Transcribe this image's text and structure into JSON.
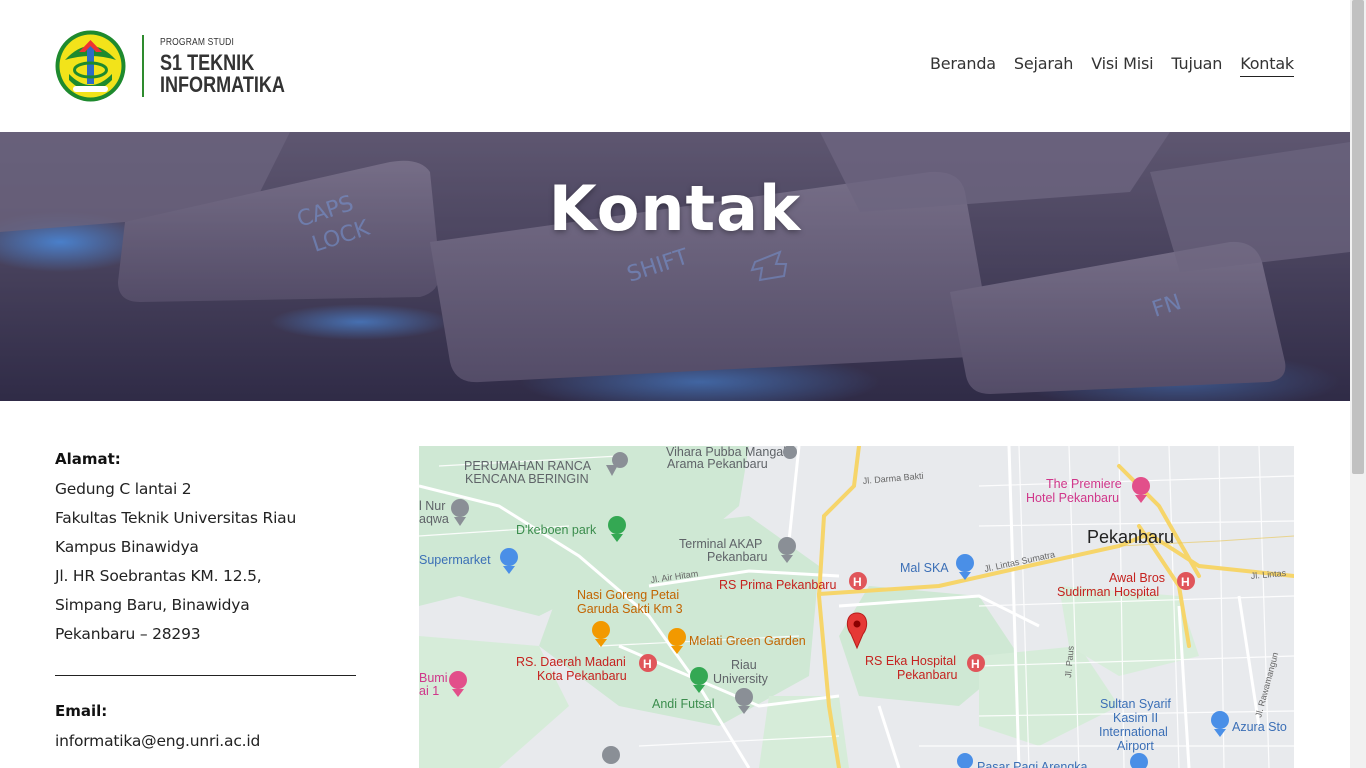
{
  "header": {
    "logo_small": "PROGRAM STUDI",
    "logo_line1": "S1 TEKNIK",
    "logo_line2": "INFORMATIKA"
  },
  "nav": {
    "items": [
      {
        "label": "Beranda",
        "active": false
      },
      {
        "label": "Sejarah",
        "active": false
      },
      {
        "label": "Visi Misi",
        "active": false
      },
      {
        "label": "Tujuan",
        "active": false
      },
      {
        "label": "Kontak",
        "active": true
      }
    ]
  },
  "hero": {
    "title": "Kontak",
    "keys": [
      "CAPS LOCK",
      "SHIFT",
      "FN"
    ]
  },
  "contact": {
    "address_heading": "Alamat:",
    "address_lines": [
      "Gedung C lantai 2",
      "Fakultas Teknik Universitas Riau",
      "Kampus Binawidya",
      "Jl. HR Soebrantas KM. 12.5,",
      "Simpang Baru, Binawidya",
      "Pekanbaru – 28293"
    ],
    "email_heading": "Email:",
    "email": "informatika@eng.unri.ac.id"
  },
  "map": {
    "city": "Pekanbaru",
    "labels": {
      "vihara": "Vihara Pubba Mangala",
      "vihara2": "Arama Pekanbaru",
      "perumahan1": "PERUMAHAN RANCA",
      "perumahan2": "KENCANA BERINGIN",
      "nur1": "l Nur",
      "nur2": "aqwa",
      "dkeboen": "D'keboen park",
      "terminal1": "Terminal AKAP",
      "terminal2": "Pekanbaru",
      "supermarket": "Supermarket",
      "airhitam": "Jl. Air Hitam",
      "rsprima": "RS Prima Pekanbaru",
      "malska": "Mal SKA",
      "darmabakti": "Jl. Darma Bakti",
      "premiere1": "The Premiere",
      "premiere2": "Hotel Pekanbaru",
      "lintassumatra": "Jl. Lintas Sumatra",
      "awalbros1": "Awal Bros",
      "awalbros2": "Sudirman Hospital",
      "jllintas": "Jl. Lintas",
      "nasi1": "Nasi Goreng Petai",
      "nasi2": "Garuda Sakti Km 3",
      "melati": "Melati Green Garden",
      "madani1": "RS. Daerah Madani",
      "madani2": "Kota Pekanbaru",
      "riau1": "Riau",
      "riau2": "University",
      "eka1": "RS Eka Hospital",
      "eka2": "Pekanbaru",
      "jlpaus": "Jl. Paus",
      "rawamangun": "Jl. Rawamangun",
      "bumi1": "Bumi",
      "bumi2": "ai 1",
      "andifutsal": "Andi Futsal",
      "sultan1": "Sultan Syarif",
      "sultan2": "Kasim II",
      "sultan3": "International",
      "sultan4": "Airport",
      "azura": "Azura Sto",
      "pasar": "Pasar Pagi Arengka"
    }
  },
  "colors": {
    "accent_green": "#2e8b2e",
    "map_marker": "#e53935",
    "hospital_red": "#e0555a",
    "food_orange": "#f29900",
    "park_green": "#34a853",
    "poi_blue": "#4a8fe7"
  }
}
